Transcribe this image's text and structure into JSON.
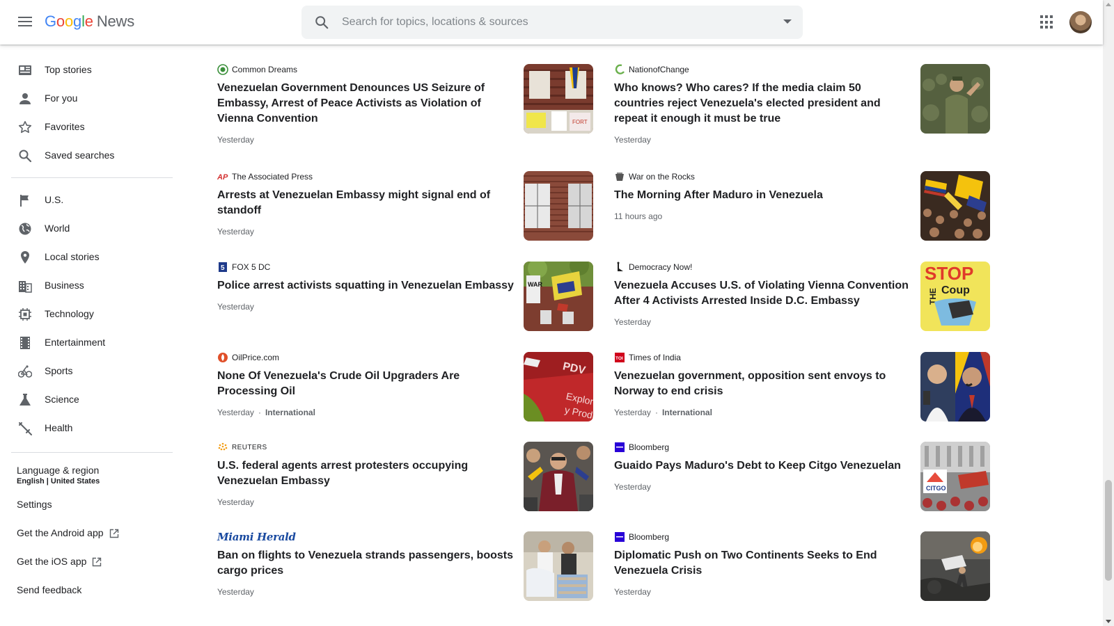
{
  "header": {
    "logo_letters": [
      "G",
      "o",
      "o",
      "g",
      "l",
      "e"
    ],
    "logo_product": "News",
    "search_placeholder": "Search for topics, locations & sources"
  },
  "sidebar": {
    "primary": [
      {
        "label": "Top stories",
        "icon": "top-stories-icon"
      },
      {
        "label": "For you",
        "icon": "person-icon"
      },
      {
        "label": "Favorites",
        "icon": "star-icon"
      },
      {
        "label": "Saved searches",
        "icon": "search-icon"
      }
    ],
    "sections": [
      {
        "label": "U.S.",
        "icon": "flag-icon"
      },
      {
        "label": "World",
        "icon": "globe-icon"
      },
      {
        "label": "Local stories",
        "icon": "location-pin-icon"
      },
      {
        "label": "Business",
        "icon": "building-icon"
      },
      {
        "label": "Technology",
        "icon": "chip-icon"
      },
      {
        "label": "Entertainment",
        "icon": "film-icon"
      },
      {
        "label": "Sports",
        "icon": "bike-icon"
      },
      {
        "label": "Science",
        "icon": "flask-icon"
      },
      {
        "label": "Health",
        "icon": "health-icon"
      }
    ],
    "language_label": "Language & region",
    "language_value": "English | United States",
    "settings": "Settings",
    "android_app": "Get the Android app",
    "ios_app": "Get the iOS app",
    "feedback": "Send feedback"
  },
  "articles": [
    {
      "source": "Common Dreams",
      "headline": "Venezuelan Government Denounces US Seizure of Embassy, Arrest of Peace Activists as Violation of Vienna Convention",
      "time": "Yesterday",
      "tag": "",
      "logo_color": "#3a8f3a"
    },
    {
      "source": "NationofChange",
      "headline": "Who knows? Who cares? If the media claim 50 countries reject Venezuela's elected president and repeat it enough it must be true",
      "time": "Yesterday",
      "tag": "",
      "logo_color": "#6ab04c"
    },
    {
      "source": "The Associated Press",
      "headline": "Arrests at Venezuelan Embassy might signal end of standoff",
      "time": "Yesterday",
      "tag": "",
      "logo_color": "#d32f2f"
    },
    {
      "source": "War on the Rocks",
      "headline": "The Morning After Maduro in Venezuela",
      "time": "11 hours ago",
      "tag": "",
      "logo_color": "#555555"
    },
    {
      "source": "FOX 5 DC",
      "headline": "Police arrest activists squatting in Venezuelan Embassy",
      "time": "Yesterday",
      "tag": "",
      "logo_color": "#1e3a8a"
    },
    {
      "source": "Democracy Now!",
      "headline": "Venezuela Accuses U.S. of Violating Vienna Convention After 4 Activists Arrested Inside D.C. Embassy",
      "time": "Yesterday",
      "tag": "",
      "logo_color": "#222222"
    },
    {
      "source": "OilPrice.com",
      "headline": "None Of Venezuela's Crude Oil Upgraders Are Processing Oil",
      "time": "Yesterday",
      "tag": "International",
      "logo_color": "#e0502a"
    },
    {
      "source": "Times of India",
      "headline": "Venezuelan government, opposition sent envoys to Norway to end crisis",
      "time": "Yesterday",
      "tag": "International",
      "logo_color": "#d0021b"
    },
    {
      "source": "REUTERS",
      "headline": "U.S. federal agents arrest protesters occupying Venezuelan Embassy",
      "time": "Yesterday",
      "tag": "",
      "logo_color": "#f39c12"
    },
    {
      "source": "Bloomberg",
      "headline": "Guaido Pays Maduro's Debt to Keep Citgo Venezuelan",
      "time": "Yesterday",
      "tag": "",
      "logo_color": "#2800d7"
    },
    {
      "source": "Miami Herald",
      "headline": "Ban on flights to Venezuela strands passengers, boosts cargo prices",
      "time": "Yesterday",
      "tag": "",
      "logo_color": "#1a4aa0"
    },
    {
      "source": "Bloomberg",
      "headline": "Diplomatic Push on Two Continents Seeks to End Venezuela Crisis",
      "time": "Yesterday",
      "tag": "",
      "logo_color": "#2800d7"
    }
  ],
  "colors": {
    "accent_blue": "#4285f4",
    "text_primary": "#202124",
    "text_secondary": "#5f6368",
    "divider": "#dadce0"
  }
}
